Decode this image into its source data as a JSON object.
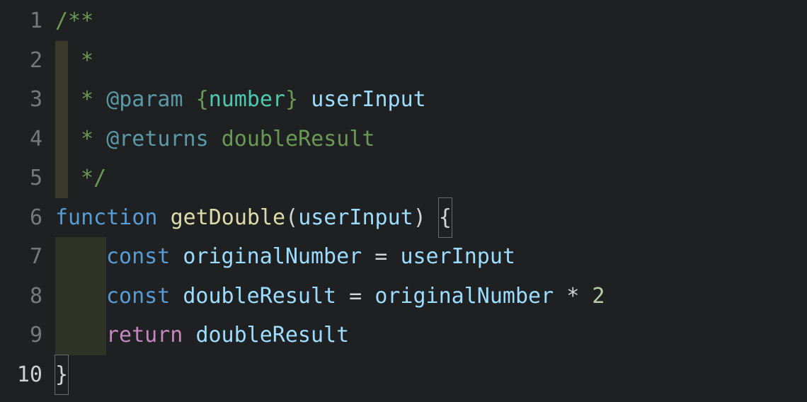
{
  "editor": {
    "currentLine": 10,
    "lineNumbers": [
      "1",
      "2",
      "3",
      "4",
      "5",
      "6",
      "7",
      "8",
      "9",
      "10"
    ],
    "lines": {
      "l1": {
        "comment_open": "/**"
      },
      "l2": {
        "star": " *"
      },
      "l3": {
        "star": " * ",
        "tag": "@param",
        "brace_open": " {",
        "type": "number",
        "brace_close": "} ",
        "param": "userInput"
      },
      "l4": {
        "star": " * ",
        "tag": "@returns",
        "space": " ",
        "value": "doubleResult"
      },
      "l5": {
        "close": " */"
      },
      "l6": {
        "kw": "function",
        "sp1": " ",
        "fn": "getDouble",
        "paren_open": "(",
        "arg": "userInput",
        "paren_close": ")",
        "sp2": " ",
        "brace": "{"
      },
      "l7": {
        "kw": "const",
        "sp1": " ",
        "var1": "originalNumber",
        "eq": " = ",
        "var2": "userInput"
      },
      "l8": {
        "kw": "const",
        "sp1": " ",
        "var1": "doubleResult",
        "eq": " = ",
        "var2": "originalNumber",
        "op": " * ",
        "num": "2"
      },
      "l9": {
        "kw": "return",
        "sp1": " ",
        "var1": "doubleResult"
      },
      "l10": {
        "brace": "}"
      }
    }
  }
}
